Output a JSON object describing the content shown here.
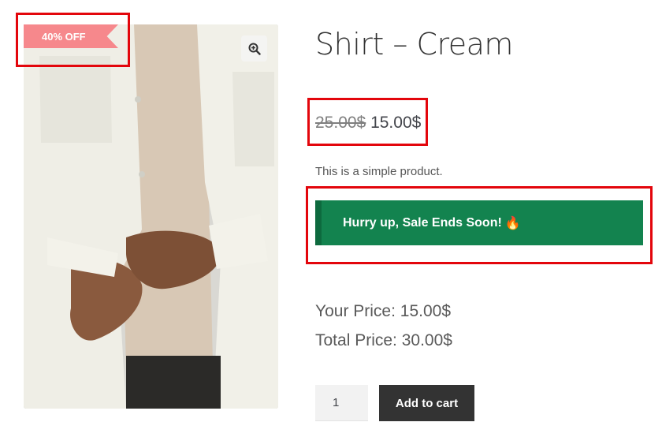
{
  "product": {
    "title": "Shirt – Cream",
    "regular_price": "25.00$",
    "sale_price": "15.00$",
    "short_description": "This is a simple product.",
    "sale_badge": "40% OFF"
  },
  "notice": {
    "text": "Hurry up, Sale Ends Soon!",
    "icon": "fire-icon",
    "emoji": "🔥",
    "color": "#13834f"
  },
  "pricing": {
    "your_price": "Your Price: 15.00$",
    "total_price": "Total Price: 30.00$"
  },
  "cart": {
    "quantity": "1",
    "add_to_cart_label": "Add to cart"
  },
  "colors": {
    "badge": "#f6888c",
    "annotation": "#e3060c",
    "button": "#333333"
  },
  "icons": {
    "zoom": "zoom-in-icon"
  }
}
